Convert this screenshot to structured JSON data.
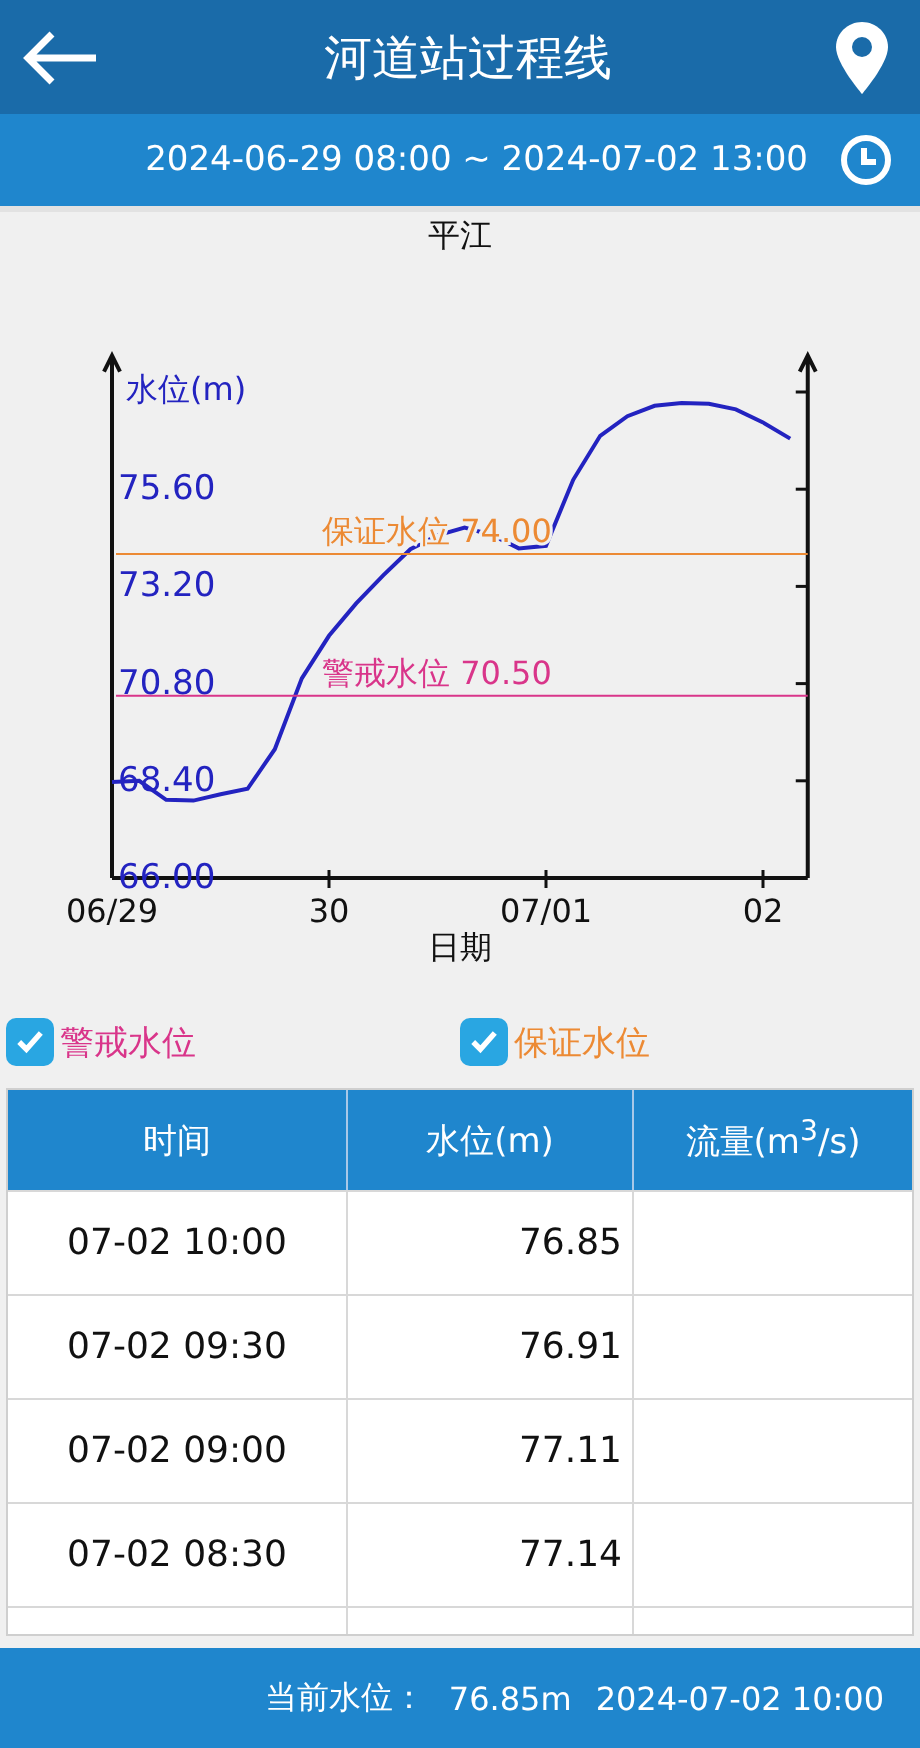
{
  "header": {
    "title": "河道站过程线"
  },
  "time_range": "2024-06-29 08:00 ~ 2024-07-02 13:00",
  "chart": {
    "chart_data": {
      "type": "line",
      "title": "平江",
      "xlabel": "日期",
      "ylabel": "水位(m)",
      "categories": [
        "06/29",
        null,
        null,
        null,
        null,
        null,
        null,
        null,
        "30",
        null,
        null,
        null,
        null,
        null,
        null,
        null,
        "07/01",
        null,
        null,
        null,
        null,
        null,
        null,
        null,
        "02",
        null
      ],
      "series": [
        {
          "color": "#2323c0",
          "values": [
            68.37,
            68.4,
            67.93,
            67.91,
            68.07,
            68.2,
            69.18,
            70.93,
            71.98,
            72.78,
            73.47,
            74.12,
            74.46,
            74.65,
            74.47,
            74.14,
            74.2,
            75.83,
            76.92,
            77.4,
            77.66,
            77.73,
            77.71,
            77.57,
            77.25,
            76.85
          ]
        }
      ],
      "ylim": [
        66,
        78.9
      ],
      "yticks": [
        {
          "value": 66,
          "label": "66.00"
        },
        {
          "value": 68.4,
          "label": "68.40"
        },
        {
          "value": 70.8,
          "label": "70.80"
        },
        {
          "value": 73.2,
          "label": "73.20"
        },
        {
          "value": 75.6,
          "label": "75.60"
        }
      ],
      "ref_lines": [
        {
          "axis": "y",
          "value": 70.5,
          "label": "警戒水位 70.50",
          "color": "#d9358a"
        },
        {
          "axis": "y",
          "value": 74.0,
          "label": "保证水位 74.00",
          "color": "#ec8a34"
        }
      ]
    }
  },
  "toggles": [
    {
      "label": "警戒水位",
      "checked": true
    },
    {
      "label": "保证水位",
      "checked": true
    }
  ],
  "table": {
    "columns": [
      "时间",
      "水位(m)",
      "流量(m$^{3}$/s)"
    ],
    "rows": [
      [
        "07-02 10:00",
        "76.85"
      ],
      [
        "07-02 09:30",
        "76.91"
      ],
      [
        "07-02 09:00",
        "77.11"
      ],
      [
        "07-02 08:30",
        "77.14"
      ]
    ]
  },
  "status_bar": {
    "label": "当前水位：",
    "value": "76.85m",
    "time": "2024-07-02 10:00"
  }
}
